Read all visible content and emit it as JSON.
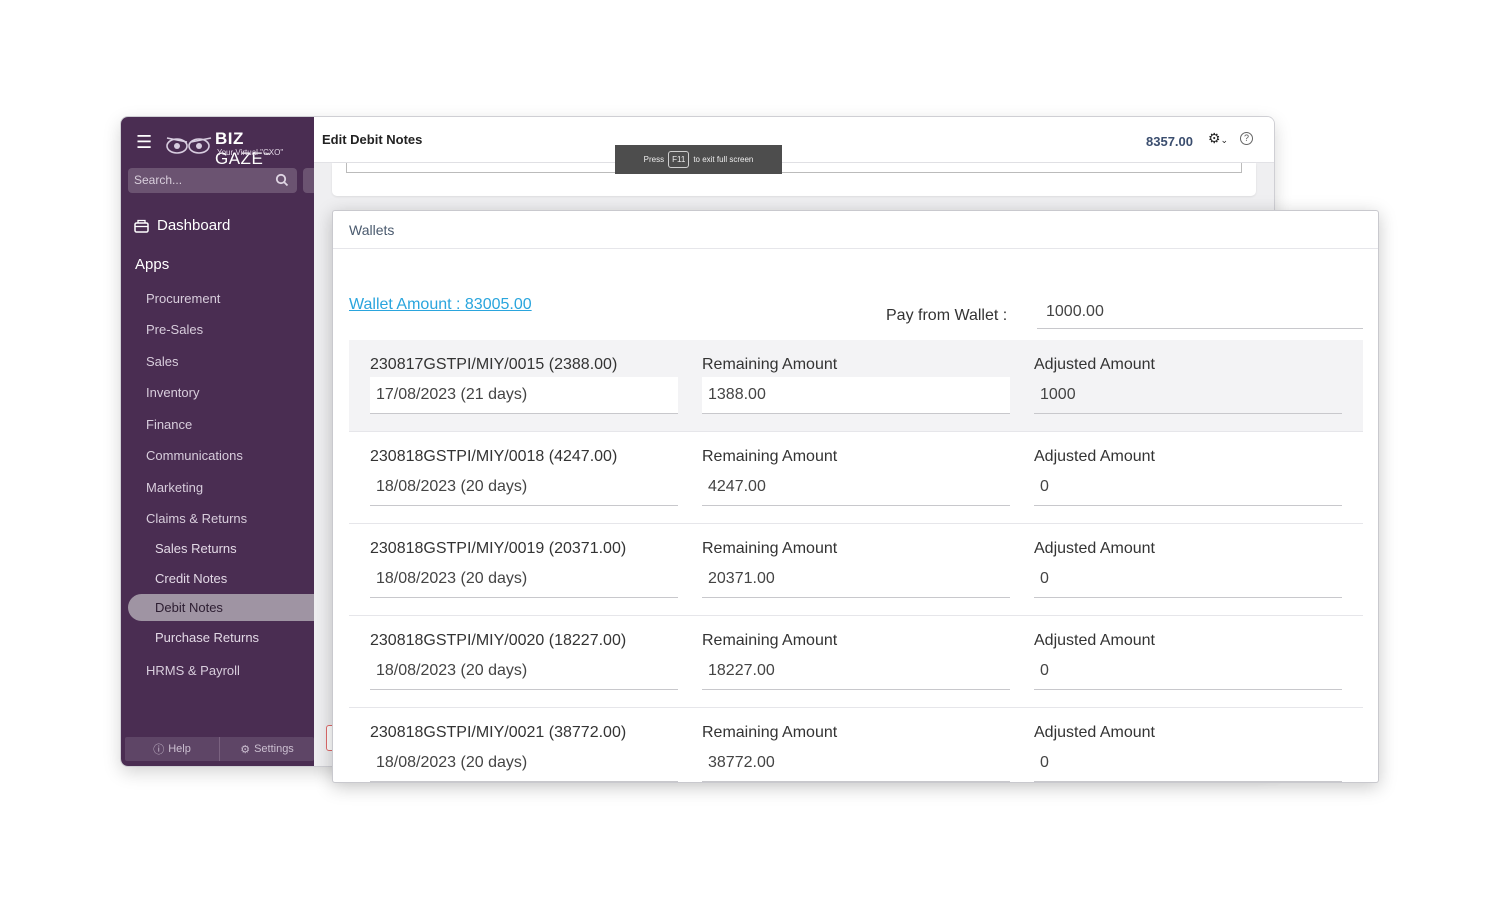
{
  "sidebar": {
    "logo_main": "BIZ",
    "logo_main2": "GAZE",
    "logo_tm": "™",
    "logo_sub": "Your Virtual \"CXO\"",
    "search_placeholder": "Search...",
    "dashboard": "Dashboard",
    "apps": "Apps",
    "items": [
      "Procurement",
      "Pre-Sales",
      "Sales",
      "Inventory",
      "Finance",
      "Communications",
      "Marketing",
      "Claims & Returns"
    ],
    "sub_items": [
      "Sales Returns",
      "Credit Notes",
      "Debit Notes",
      "Purchase Returns"
    ],
    "last_item": "HRMS & Payroll",
    "footer_help": "Help",
    "footer_settings": "Settings"
  },
  "header": {
    "title": "Edit Debit Notes",
    "amount": "8357.00",
    "fullscreen_press": "Press",
    "fullscreen_key": "F11",
    "fullscreen_rest": "to exit full screen"
  },
  "wallets": {
    "title": "Wallets",
    "wallet_amount": "Wallet Amount : 83005.00",
    "pay_label": "Pay from Wallet :",
    "pay_value": "1000.00",
    "remaining_label": "Remaining Amount",
    "adjusted_label": "Adjusted Amount",
    "rows": [
      {
        "invoice": "230817GSTPI/MIY/0015 (2388.00)",
        "date": "17/08/2023 (21 days)",
        "remaining": "1388.00",
        "adjusted": "1000"
      },
      {
        "invoice": "230818GSTPI/MIY/0018 (4247.00)",
        "date": "18/08/2023 (20 days)",
        "remaining": "4247.00",
        "adjusted": "0"
      },
      {
        "invoice": "230818GSTPI/MIY/0019 (20371.00)",
        "date": "18/08/2023 (20 days)",
        "remaining": "20371.00",
        "adjusted": "0"
      },
      {
        "invoice": "230818GSTPI/MIY/0020 (18227.00)",
        "date": "18/08/2023 (20 days)",
        "remaining": "18227.00",
        "adjusted": "0"
      },
      {
        "invoice": "230818GSTPI/MIY/0021 (38772.00)",
        "date": "18/08/2023 (20 days)",
        "remaining": "38772.00",
        "adjusted": "0"
      }
    ]
  }
}
